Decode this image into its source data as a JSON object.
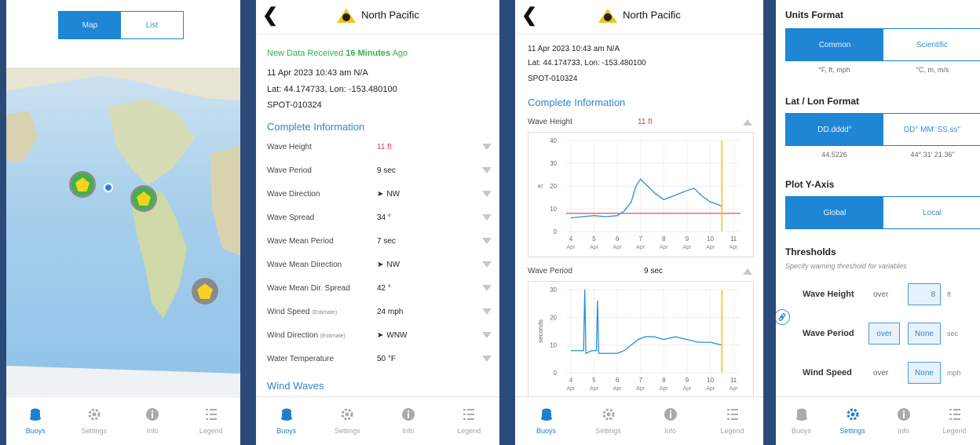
{
  "map_screen": {
    "segment": {
      "map": "Map",
      "list": "List",
      "selected": "Map"
    }
  },
  "tabs": {
    "buoys": "Buoys",
    "settings": "Settings",
    "info": "Info",
    "legend": "Legend"
  },
  "detail_screen": {
    "title": "North Pacific",
    "new_data_prefix": "New Data Received ",
    "new_data_minutes": "16 Minutes",
    "new_data_suffix": " Ago",
    "timestamp": "11 Apr 2023 10:43 am N/A",
    "latlon": "Lat: 44.174733, Lon: -153.480100",
    "spot_id": "SPOT-010324",
    "section": "Complete Information",
    "rows": [
      {
        "label": "Wave Height",
        "note": "",
        "value": "11 ft",
        "highlight": true
      },
      {
        "label": "Wave Period",
        "note": "",
        "value": "9 sec"
      },
      {
        "label": "Wave Direction",
        "note": "",
        "value": "NW",
        "arrow": true
      },
      {
        "label": "Wave Spread",
        "note": "",
        "value": "34 °"
      },
      {
        "label": "Wave Mean Period",
        "note": "",
        "value": "7 sec"
      },
      {
        "label": "Wave Mean Direction",
        "note": "",
        "value": "NW",
        "arrow": true
      },
      {
        "label": "Wave Mean Dir. Spread",
        "note": "",
        "value": "42 °"
      },
      {
        "label": "Wind Speed",
        "note": "(Estimate)",
        "value": "24 mph"
      },
      {
        "label": "Wind Direction",
        "note": "(Estimate)",
        "value": "WNW",
        "arrow": true
      },
      {
        "label": "Water Temperature",
        "note": "",
        "value": "50 °F"
      }
    ],
    "next_section": "Wind Waves"
  },
  "chart_screen": {
    "title": "North Pacific",
    "timestamp": "11 Apr 2023 10:43 am N/A",
    "latlon": "Lat: 44.174733, Lon: -153.480100",
    "spot_id": "SPOT-010324",
    "section": "Complete Information",
    "chart1_label": "Wave Height",
    "chart1_value": "11 ft",
    "chart2_label": "Wave Period",
    "chart2_value": "9 sec"
  },
  "chart_data": [
    {
      "type": "line",
      "title": "Wave Height",
      "ylabel": "ft",
      "x_ticks": [
        "4 Apr",
        "5 Apr",
        "6 Apr",
        "7 Apr",
        "8 Apr",
        "9 Apr",
        "10 Apr",
        "11 Apr"
      ],
      "ylim": [
        0,
        40
      ],
      "y_ticks": [
        0,
        10,
        20,
        30,
        40
      ],
      "threshold": 8,
      "threshold_color": "#e06060",
      "current_marker_x": 10.5,
      "series": [
        {
          "color": "#2a8de0",
          "x": [
            4,
            4.5,
            5,
            5.5,
            6,
            6.3,
            6.6,
            6.8,
            7,
            7.3,
            7.6,
            8,
            8.5,
            9,
            9.3,
            9.6,
            10,
            10.3,
            10.5
          ],
          "values": [
            6,
            6.5,
            7,
            6.5,
            7,
            9,
            13,
            20,
            23,
            20,
            17,
            14,
            16,
            18,
            19,
            16,
            13,
            12,
            11
          ]
        }
      ]
    },
    {
      "type": "line",
      "title": "Wave Period",
      "ylabel": "seconds",
      "x_ticks": [
        "4 Apr",
        "5 Apr",
        "6 Apr",
        "7 Apr",
        "8 Apr",
        "9 Apr",
        "10 Apr",
        "11 Apr"
      ],
      "ylim": [
        0,
        30
      ],
      "y_ticks": [
        0,
        10,
        20,
        30
      ],
      "current_marker_x": 10.5,
      "series": [
        {
          "color": "#2a8de0",
          "x": [
            4,
            4.3,
            4.55,
            4.6,
            4.65,
            4.9,
            5.1,
            5.15,
            5.2,
            5.6,
            6,
            6.3,
            6.6,
            6.9,
            7.2,
            7.6,
            8,
            8.5,
            9,
            9.5,
            10,
            10.5
          ],
          "values": [
            8,
            8,
            8,
            30,
            7,
            8,
            8,
            26,
            7,
            7,
            7,
            8,
            10,
            12,
            13,
            13,
            12,
            13,
            12,
            11,
            11,
            10
          ]
        }
      ]
    }
  ],
  "settings_screen": {
    "units_title": "Units Format",
    "units_on": "Common",
    "units_off": "Scientific",
    "units_sub_on": "°F, ft, mph",
    "units_sub_off": "°C, m, m/s",
    "latlon_title": "Lat / Lon Format",
    "latlon_on": "DD.dddd°",
    "latlon_off": "DD° MM' SS.ss\"",
    "latlon_sub_on": "44.5226",
    "latlon_sub_off": "44° 31' 21.36\"",
    "yaxis_title": "Plot Y-Axis",
    "yaxis_on": "Global",
    "yaxis_off": "Local",
    "thresholds_title": "Thresholds",
    "thresholds_desc": "Specify warning threshold for variables",
    "thresholds": [
      {
        "label": "Wave Height",
        "op": "over",
        "op_boxed": false,
        "value": "8",
        "unit": "ft"
      },
      {
        "label": "Wave Period",
        "op": "over",
        "op_boxed": true,
        "value": "None",
        "unit": "sec"
      },
      {
        "label": "Wind Speed",
        "op": "over",
        "op_boxed": false,
        "value": "None",
        "unit": "mph"
      }
    ]
  },
  "colors": {
    "accent": "#1f86d6",
    "highlight": "#e04040",
    "new_data": "#2db24a",
    "buoy": "#f7d21e",
    "threshold": "#e06060",
    "marker": "#f0c419"
  }
}
